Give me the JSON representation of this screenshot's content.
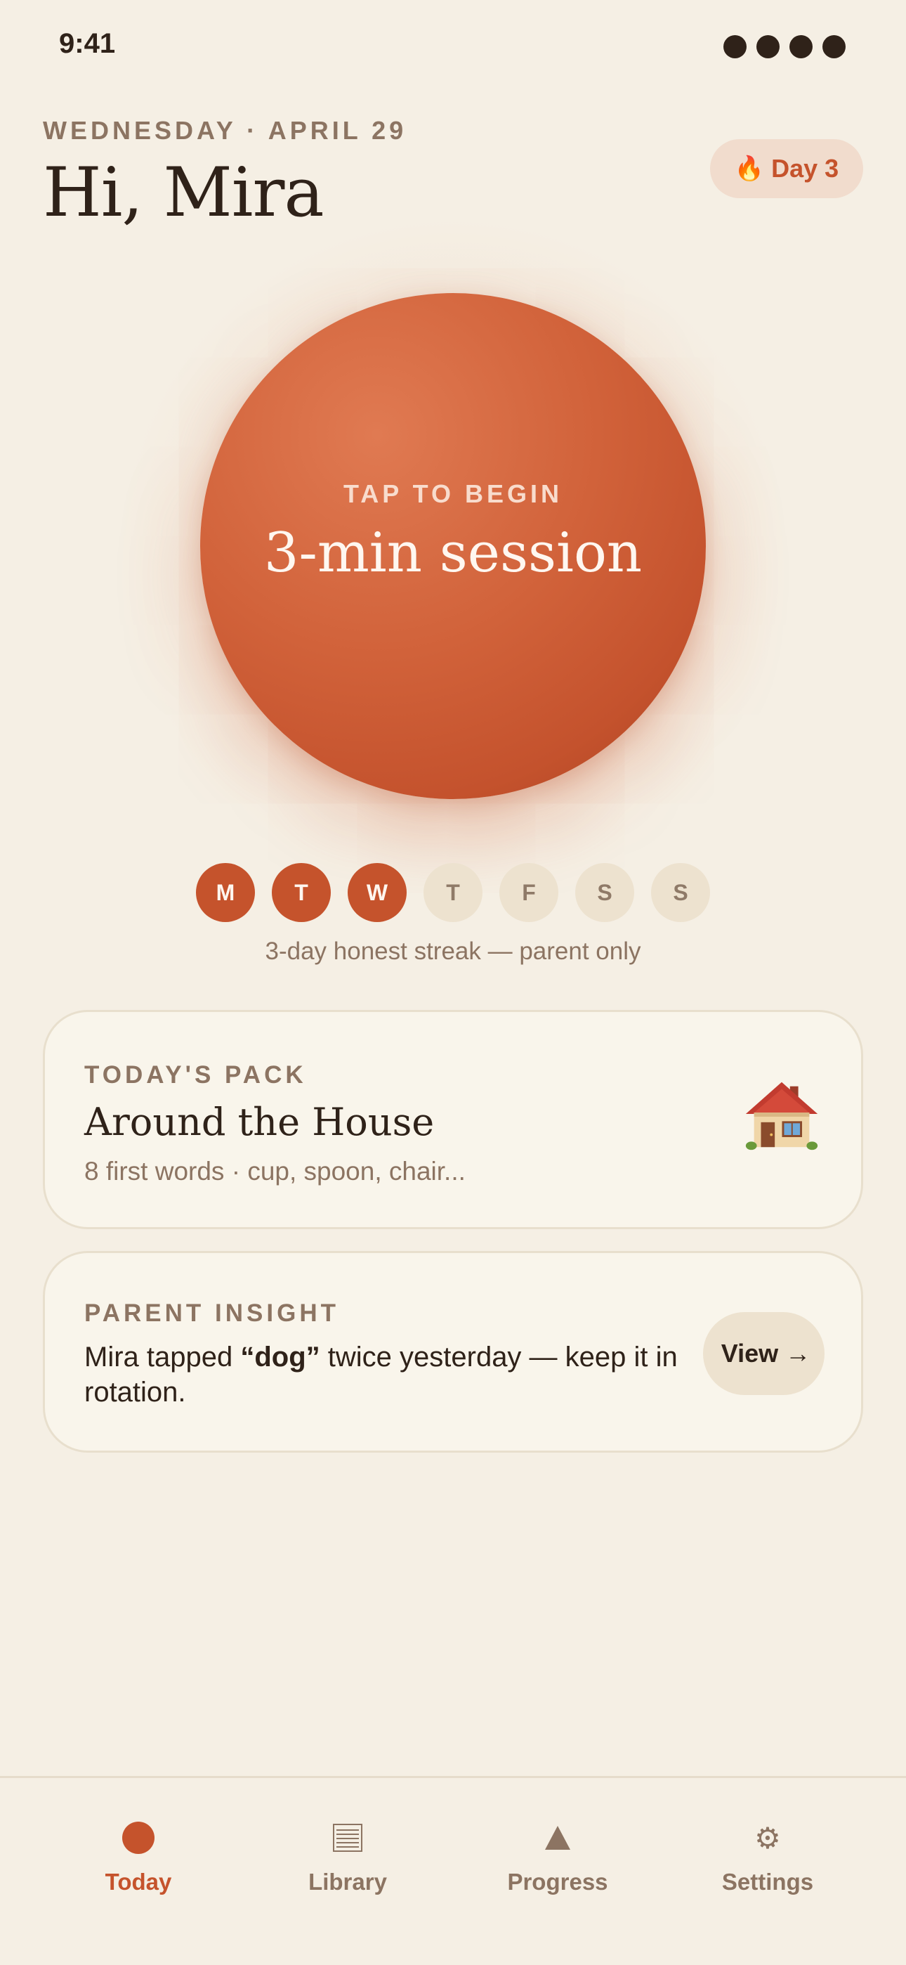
{
  "status_bar": {
    "time": "9:41"
  },
  "header": {
    "date": "WEDNESDAY · APRIL 29",
    "greeting": "Hi, Mira",
    "streak_badge": {
      "icon": "flame-icon",
      "label": "Day 3"
    }
  },
  "session": {
    "kicker": "TAP TO BEGIN",
    "title": "3-min session"
  },
  "week": {
    "days": [
      {
        "letter": "M",
        "done": true
      },
      {
        "letter": "T",
        "done": true
      },
      {
        "letter": "W",
        "done": true
      },
      {
        "letter": "T",
        "done": false
      },
      {
        "letter": "F",
        "done": false
      },
      {
        "letter": "S",
        "done": false
      },
      {
        "letter": "S",
        "done": false
      }
    ],
    "note": "3-day honest streak — parent only"
  },
  "pack_card": {
    "kicker": "TODAY'S PACK",
    "title": "Around the House",
    "subtitle": "8 first words · cup, spoon, chair...",
    "icon": "house-icon"
  },
  "insight_card": {
    "kicker": "PARENT INSIGHT",
    "text_before": "Mira tapped ",
    "highlight": "“dog”",
    "text_after": " twice yesterday — keep it in rotation.",
    "button_label": "View →"
  },
  "tabbar": {
    "items": [
      {
        "label": "Today",
        "icon": "circle-icon",
        "active": true
      },
      {
        "label": "Library",
        "icon": "list-icon",
        "active": false
      },
      {
        "label": "Progress",
        "icon": "triangle-icon",
        "active": false
      },
      {
        "label": "Settings",
        "icon": "gear-icon",
        "active": false
      }
    ]
  },
  "colors": {
    "background": "#f5efe4",
    "accent": "#c5532c",
    "muted": "#8c7462",
    "ink": "#2f2219"
  }
}
